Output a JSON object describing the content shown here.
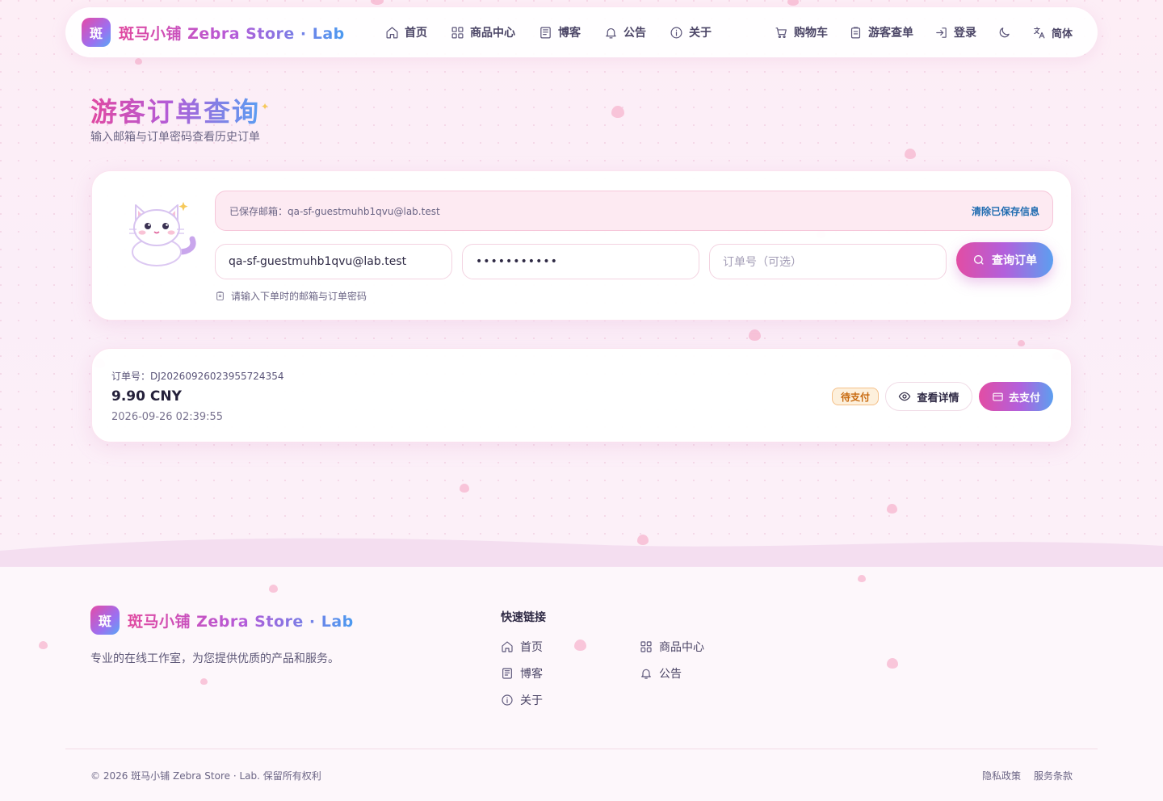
{
  "nav": {
    "logo_char": "斑",
    "brand": "斑马小铺 Zebra Store · Lab",
    "items": [
      {
        "label": "首页",
        "icon": "home-icon"
      },
      {
        "label": "商品中心",
        "icon": "grid-icon"
      },
      {
        "label": "博客",
        "icon": "newspaper-icon"
      },
      {
        "label": "公告",
        "icon": "bell-icon"
      },
      {
        "label": "关于",
        "icon": "info-icon"
      }
    ],
    "cart": "购物车",
    "guest_order": "游客查单",
    "login": "登录",
    "language": "简体"
  },
  "page": {
    "title": "游客订单查询",
    "subtitle": "输入邮箱与订单密码查看历史订单"
  },
  "query": {
    "saved_email_text": "已保存邮箱：qa-sf-guestmuhb1qvu@lab.test",
    "clear_saved": "清除已保存信息",
    "email_value": "qa-sf-guestmuhb1qvu@lab.test",
    "password_value": "•••••••••••",
    "order_no_placeholder": "订单号（可选）",
    "submit": "查询订单",
    "hint": "请输入下单时的邮箱与订单密码"
  },
  "order": {
    "order_no": "订单号：DJ20260926023955724354",
    "amount": "9.90 CNY",
    "time": "2026-09-26 02:39:55",
    "status": "待支付",
    "view_detail": "查看详情",
    "pay": "去支付"
  },
  "footer": {
    "logo_char": "斑",
    "brand": "斑马小铺 Zebra Store · Lab",
    "description": "专业的在线工作室，为您提供优质的产品和服务。",
    "quick_links_title": "快速链接",
    "links": [
      {
        "label": "首页",
        "icon": "home-icon"
      },
      {
        "label": "商品中心",
        "icon": "grid-icon"
      },
      {
        "label": "博客",
        "icon": "newspaper-icon"
      },
      {
        "label": "公告",
        "icon": "bell-icon"
      },
      {
        "label": "关于",
        "icon": "info-icon"
      }
    ],
    "copyright": "© 2026 斑马小铺 Zebra Store · Lab. 保留所有权利",
    "privacy": "隐私政策",
    "terms": "服务条款"
  },
  "colors": {
    "accent_pink": "#e24da4",
    "accent_purple": "#b260dc",
    "accent_blue": "#5c9ff0",
    "status_pending": "#c86a10"
  }
}
